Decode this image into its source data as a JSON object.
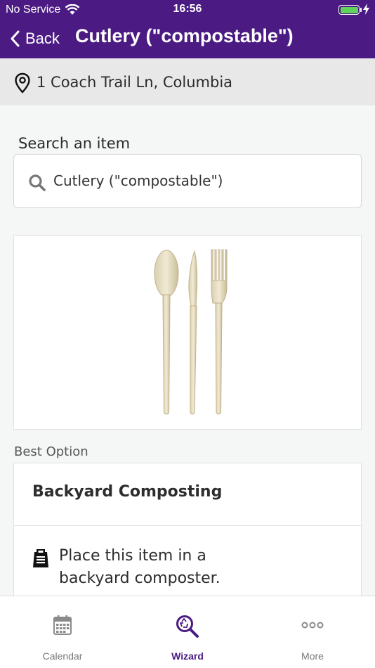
{
  "status_bar": {
    "carrier": "No Service",
    "time": "16:56"
  },
  "nav": {
    "back_label": "Back",
    "title": "Cutlery (\"compostable\")"
  },
  "location": {
    "address": "1 Coach Trail Ln, Columbia"
  },
  "search": {
    "label": "Search an item",
    "value": "Cutlery (\"compostable\")"
  },
  "result": {
    "best_label": "Best Option",
    "option_title": "Backyard Composting",
    "option_description": "Place this item in a backyard composter."
  },
  "tabs": [
    {
      "label": "Calendar",
      "icon": "calendar-icon",
      "active": false
    },
    {
      "label": "Wizard",
      "icon": "wizard-search-icon",
      "active": true
    },
    {
      "label": "More",
      "icon": "more-dots-icon",
      "active": false
    }
  ],
  "colors": {
    "brand": "#4b1b83",
    "battery": "#5fd35b"
  }
}
